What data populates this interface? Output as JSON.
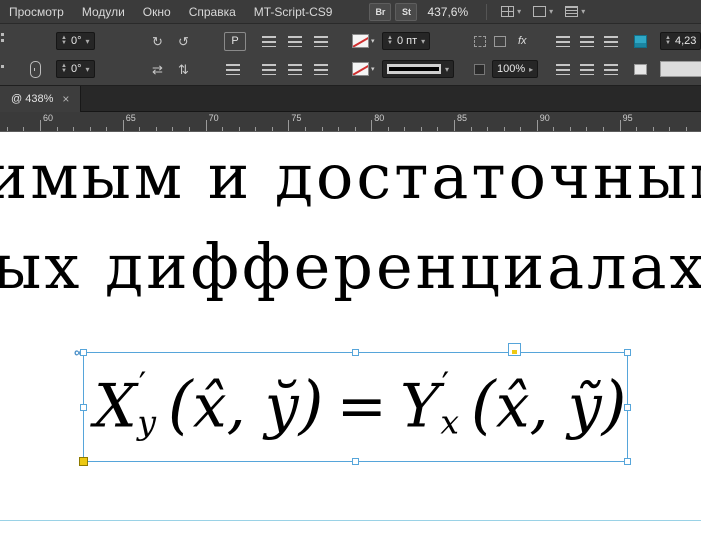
{
  "menu": {
    "items": [
      "Просмотр",
      "Модули",
      "Окно",
      "Справка",
      "MT-Script-CS9"
    ]
  },
  "appbar": {
    "bridge": "Br",
    "stock": "St",
    "zoom": "437,6%"
  },
  "panel": {
    "rotation": "0°",
    "shear": "0°",
    "p_label": "P",
    "stroke_weight": "0 пт",
    "effect_scale": "100%",
    "fx": "fx",
    "right_field": "4,23"
  },
  "tab": {
    "label": "@ 438%",
    "close": "×"
  },
  "ruler": {
    "numbers": [
      "60",
      "65",
      "70",
      "75",
      "80",
      "85",
      "90",
      "95"
    ]
  },
  "doc": {
    "line1": "имым и достаточным",
    "line2": "ых дифференциалах з"
  },
  "formula": {
    "lhs_base": "X",
    "lhs_prime": "′",
    "lhs_sub": "y",
    "open": "(",
    "x_hat": "x̂",
    "comma": ",",
    "y_breve": "y̆",
    "close": ")",
    "equals": "=",
    "rhs_base": "Y",
    "rhs_prime": "′",
    "rhs_sub": "x",
    "y_tilde": "ỹ"
  }
}
